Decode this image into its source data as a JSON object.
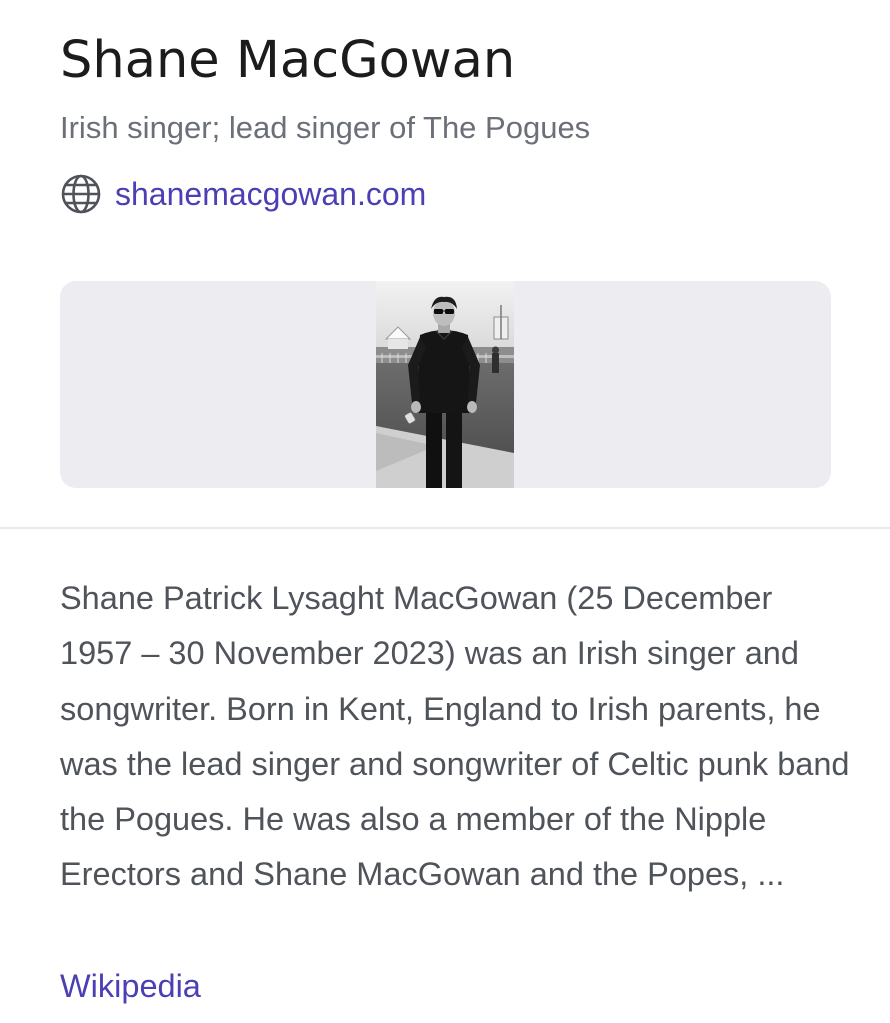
{
  "entity": {
    "title": "Shane MacGowan",
    "subtitle": "Irish singer; lead singer of The Pogues",
    "website": {
      "icon": "globe-icon",
      "label": "shanemacgowan.com"
    }
  },
  "media": {
    "image_alt": "Shane MacGowan"
  },
  "description": {
    "text": "Shane Patrick Lysaght MacGowan (25 December 1957 – 30 November 2023) was an Irish singer and songwriter. Born in Kent, England to Irish parents, he was the lead singer and songwriter of Celtic punk band the Pogues. He was also a member of the Nipple Erectors and Shane MacGowan and the Popes, ...",
    "source_label": "Wikipedia"
  },
  "colors": {
    "link": "#4a3fb4",
    "title": "#1c1c1c",
    "muted_text": "#6b6f78",
    "body_text": "#4f535a",
    "media_background": "#ededf1",
    "divider": "#e9e9ed"
  }
}
